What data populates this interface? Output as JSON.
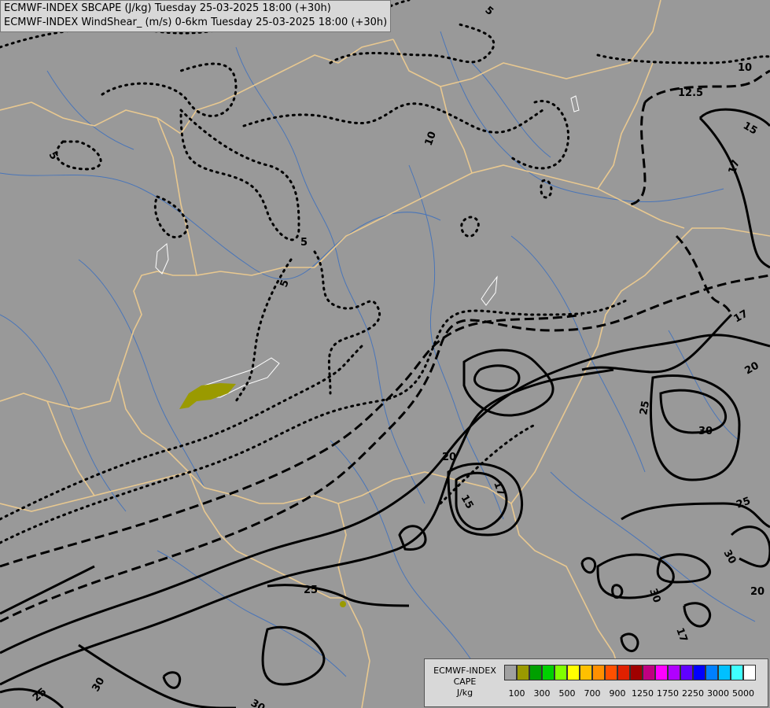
{
  "titles": {
    "line1": "ECMWF-INDEX SBCAPE (J/kg) Tuesday 25-03-2025 18:00 (+30h)",
    "line2": "ECMWF-INDEX WindShear_ (m/s) 0-6km Tuesday 25-03-2025 18:00 (+30h)"
  },
  "legend": {
    "title_line1": "ECMWF-INDEX",
    "title_line2": "CAPE",
    "title_line3": "J/kg",
    "colors": [
      "#a0a0a0",
      "#9a9a00",
      "#00a000",
      "#00d000",
      "#80ff00",
      "#ffff00",
      "#ffc000",
      "#ff9000",
      "#ff5000",
      "#e02000",
      "#a00000",
      "#c00080",
      "#ff00ff",
      "#b000ff",
      "#6000ff",
      "#0000ff",
      "#0080ff",
      "#00c0ff",
      "#40ffff",
      "#ffffff"
    ],
    "ticks": [
      "100",
      "300",
      "500",
      "700",
      "900",
      "1250",
      "1750",
      "2250",
      "3000",
      "5000"
    ]
  },
  "contour_labels": {
    "c5a": "5",
    "c5b": "5",
    "c5c": "5",
    "c5d": "5",
    "c10a": "10",
    "c10b": "10",
    "c125": "12.5",
    "c15a": "15",
    "c15b": "15",
    "c17a": "17",
    "c17b": "17",
    "c17c": "17",
    "c17d": "17",
    "c20a": "20",
    "c20b": "20",
    "c20c": "20",
    "c25a": "25",
    "c25b": "25",
    "c25c": "25",
    "c25d": "25",
    "c30a": "30",
    "c30b": "30",
    "c30c": "30",
    "c30d": "30",
    "c30e": "30"
  }
}
